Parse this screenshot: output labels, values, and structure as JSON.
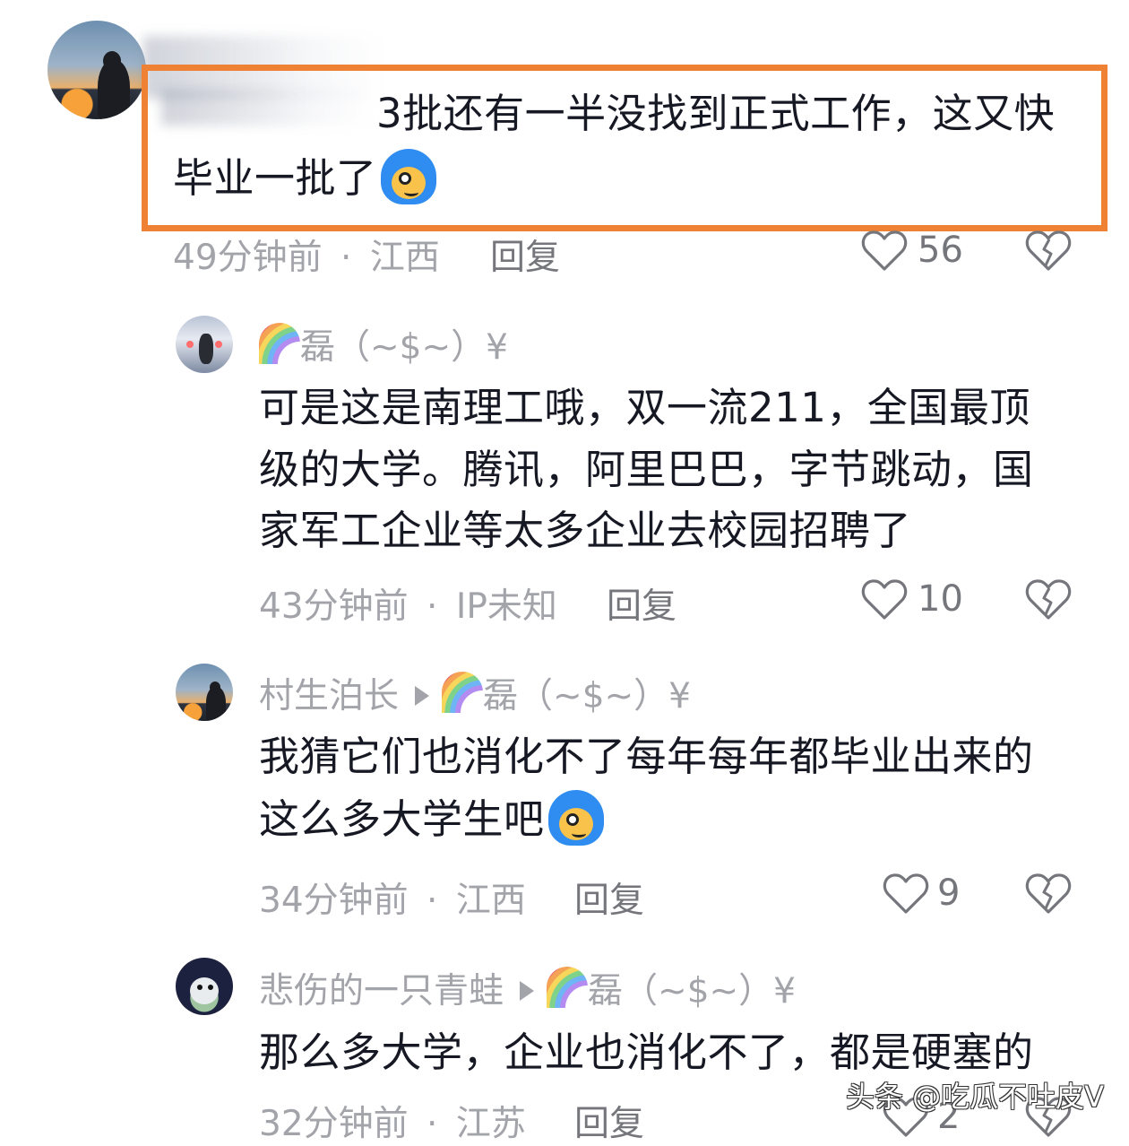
{
  "comments": [
    {
      "text_line1": "3批还有一半没找到正式工作，这又快",
      "text_line2": "毕业一批了",
      "emoji": "doge-blue-hair-emoji",
      "time": "49分钟前",
      "location": "江西",
      "reply_label": "回复",
      "likes": "56"
    },
    {
      "username": "磊（~$~）¥",
      "text_lines": [
        "可是这是南理工哦，双一流211，全国最顶",
        "级的大学。腾讯，阿里巴巴，字节跳动，国",
        "家军工企业等太多企业去校园招聘了"
      ],
      "time": "43分钟前",
      "location": "IP未知",
      "reply_label": "回复",
      "likes": "10"
    },
    {
      "username": "村生泊长",
      "reply_to": "磊（~$~）¥",
      "text_line1": "我猜它们也消化不了每年每年都毕业出来的",
      "text_line2": "这么多大学生吧",
      "emoji": "doge-blue-hair-emoji",
      "time": "34分钟前",
      "location": "江西",
      "reply_label": "回复",
      "likes": "9"
    },
    {
      "username": "悲伤的一只青蛙",
      "reply_to": "磊（~$~）¥",
      "text_line1": "那么多大学，企业也消化不了，都是硬塞的",
      "time": "32分钟前",
      "location": "江苏",
      "reply_label": "回复",
      "likes": "2"
    }
  ],
  "separator": "·",
  "watermark": "头条 @吃瓜不吐皮V",
  "colors": {
    "highlight_border": "#ee8133",
    "primary_text": "#161823",
    "meta_text": "#a3a4aa"
  }
}
